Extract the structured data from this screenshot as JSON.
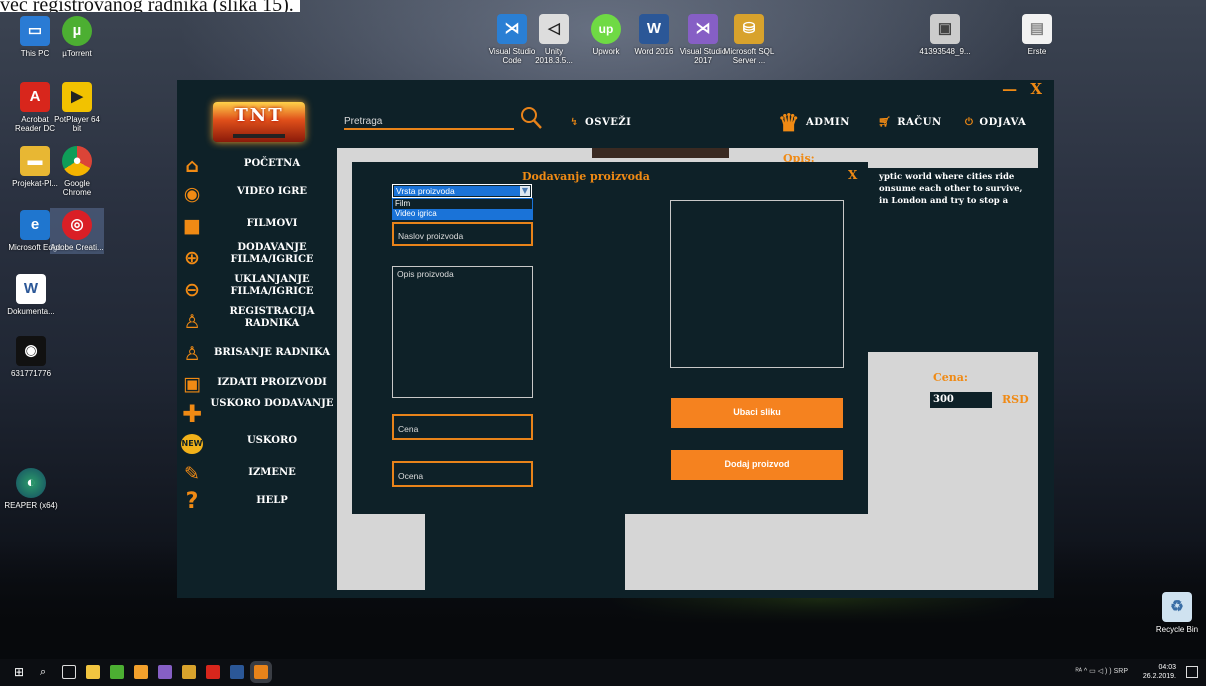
{
  "document": {
    "visible_text": "već registrovanog radnika (slika 15)."
  },
  "desktop": {
    "icons": [
      {
        "label": "This PC",
        "icon": "computer-icon"
      },
      {
        "label": "µTorrent",
        "icon": "utorrent-icon"
      },
      {
        "label": "Acrobat Reader DC",
        "icon": "acrobat-icon"
      },
      {
        "label": "PotPlayer 64 bit",
        "icon": "potplayer-icon"
      },
      {
        "label": "Projekat-Pl...",
        "icon": "folder-icon"
      },
      {
        "label": "Google Chrome",
        "icon": "chrome-icon"
      },
      {
        "label": "Microsoft Edge",
        "icon": "edge-icon"
      },
      {
        "label": "Adobe Creati...",
        "icon": "adobe-cc-icon"
      },
      {
        "label": "Dokumenta...",
        "icon": "word-doc-icon"
      },
      {
        "label": "631771776",
        "icon": "eye-app-icon"
      },
      {
        "label": "REAPER (x64)",
        "icon": "reaper-icon"
      },
      {
        "label": "Visual Studio Code",
        "icon": "vscode-icon"
      },
      {
        "label": "Unity 2018.3.5...",
        "icon": "unity-icon"
      },
      {
        "label": "Upwork",
        "icon": "upwork-icon"
      },
      {
        "label": "Word 2016",
        "icon": "word-icon"
      },
      {
        "label": "Visual Studio 2017",
        "icon": "visual-studio-icon"
      },
      {
        "label": "Microsoft SQL Server ...",
        "icon": "sql-server-icon"
      },
      {
        "label": "41393548_9...",
        "icon": "image-file-icon"
      },
      {
        "label": "Erste",
        "icon": "file-icon"
      },
      {
        "label": "Recycle Bin",
        "icon": "recycle-bin-icon"
      }
    ]
  },
  "app": {
    "logo_text": "TNT",
    "window_controls": {
      "minimize": "—",
      "close": "X"
    },
    "search_placeholder": "Pretraga",
    "top_nav": {
      "refresh": "OSVEŽI",
      "admin": "ADMIN",
      "account": "RAČUN",
      "logout": "ODJAVA"
    },
    "sidebar": [
      {
        "label": "POČETNA",
        "icon": "home-icon"
      },
      {
        "label": "VIDEO IGRE",
        "icon": "gamepad-icon"
      },
      {
        "label": "FILMOVI",
        "icon": "camera-icon"
      },
      {
        "label": "DODAVANJE FILMA/IGRICE",
        "icon": "plus-circle-icon"
      },
      {
        "label": "UKLANJANJE FILMA/IGRICE",
        "icon": "minus-circle-icon"
      },
      {
        "label": "REGISTRACIJA RADNIKA",
        "icon": "add-user-icon"
      },
      {
        "label": "BRISANJE RADNIKA",
        "icon": "remove-user-icon"
      },
      {
        "label": "IZDATI PROIZVODI",
        "icon": "box-icon"
      },
      {
        "label": "USKORO DODAVANJE",
        "icon": "plus-icon"
      },
      {
        "label": "USKORO",
        "icon": "new-badge-icon"
      },
      {
        "label": "IZMENE",
        "icon": "pencil-icon"
      },
      {
        "label": "HELP",
        "icon": "question-icon"
      }
    ],
    "details": {
      "opis_title": "Opis:",
      "description": "yptic world where cities ride onsume each other to survive, in London and try to stop a",
      "cena_title": "Cena:",
      "price": "300",
      "currency": "RSD"
    },
    "dialog": {
      "title": "Dodavanje proizvoda",
      "close": "X",
      "type_select_value": "Vrsta proizvoda",
      "type_options": [
        "Film",
        "Video igrica"
      ],
      "selected_option_index": 1,
      "title_placeholder": "Naslov proizvoda",
      "description_placeholder": "Opis proizvoda",
      "price_placeholder": "Cena",
      "rating_placeholder": "Ocena",
      "insert_image_button": "Ubaci sliku",
      "add_product_button": "Dodaj proizvod"
    }
  },
  "taskbar": {
    "language": "SRP",
    "time": "04:03",
    "date": "26.2.2019."
  }
}
